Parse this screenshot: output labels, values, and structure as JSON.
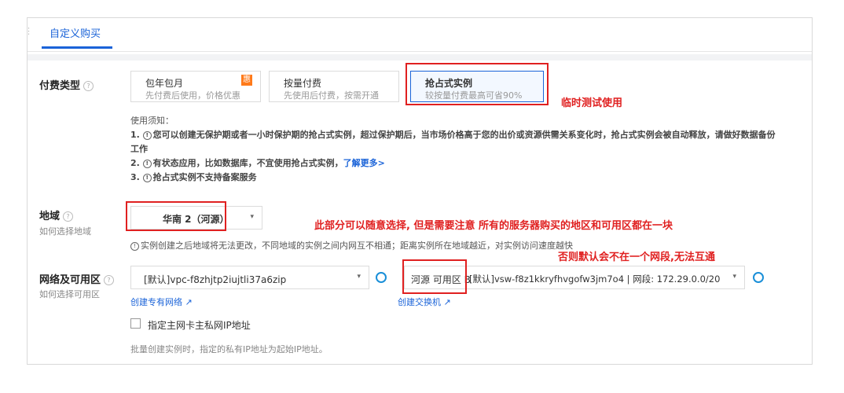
{
  "tab": {
    "label": "自定义购买"
  },
  "billing": {
    "label": "付费类型",
    "options": [
      {
        "title": "包年包月",
        "desc": "先付费后使用，价格优惠",
        "badge": "惠"
      },
      {
        "title": "按量付费",
        "desc": "先使用后付费，按需开通"
      },
      {
        "title": "抢占式实例",
        "desc": "较按量付费最高可省90%"
      }
    ],
    "annotation": "临时测试使用"
  },
  "notes": {
    "header": "使用须知：",
    "line1_prefix": "1. ",
    "line1_text": "您可以创建无保护期或者一小时保护期的抢占式实例，超过保护期后，当市场价格高于您的出价或资源供需关系变化时，抢占式实例会被自动释放，请做好数据备份工作",
    "line2_prefix": "2. ",
    "line2_text": "有状态应用，比如数据库，不宜使用抢占式实例，",
    "line2_link": "了解更多>",
    "line3_prefix": "3. ",
    "line3_text": "抢占式实例不支持备案服务"
  },
  "region": {
    "label": "地域",
    "sublabel": "如何选择地域",
    "selected": "华南 2（河源）",
    "warning": "实例创建之后地域将无法更改，不同地域的实例之间内网互不相通；距离实例所在地域越近，对实例访问速度越快",
    "annotation1": "此部分可以随意选择, 但是需要注意 所有的服务器购买的地区和可用区都在一块",
    "annotation2": "否则默认会不在一个网段,无法互通"
  },
  "network": {
    "label": "网络及可用区",
    "sublabel": "如何选择可用区",
    "vpc_value": "[默认]vpc-f8zhjtp2iujtli37a6zip",
    "vpc_link": "创建专有网络",
    "zone": "河源 可用区 B",
    "vswitch_value": "[默认]vsw-f8z1kkryfhvgofw3jm7o4 | 网段: 172.29.0.0/20",
    "vswitch_link": "创建交换机",
    "private_ip_label": "指定主网卡主私网IP地址",
    "batch_note": "批量创建实例时，指定的私有IP地址为起始IP地址。"
  }
}
